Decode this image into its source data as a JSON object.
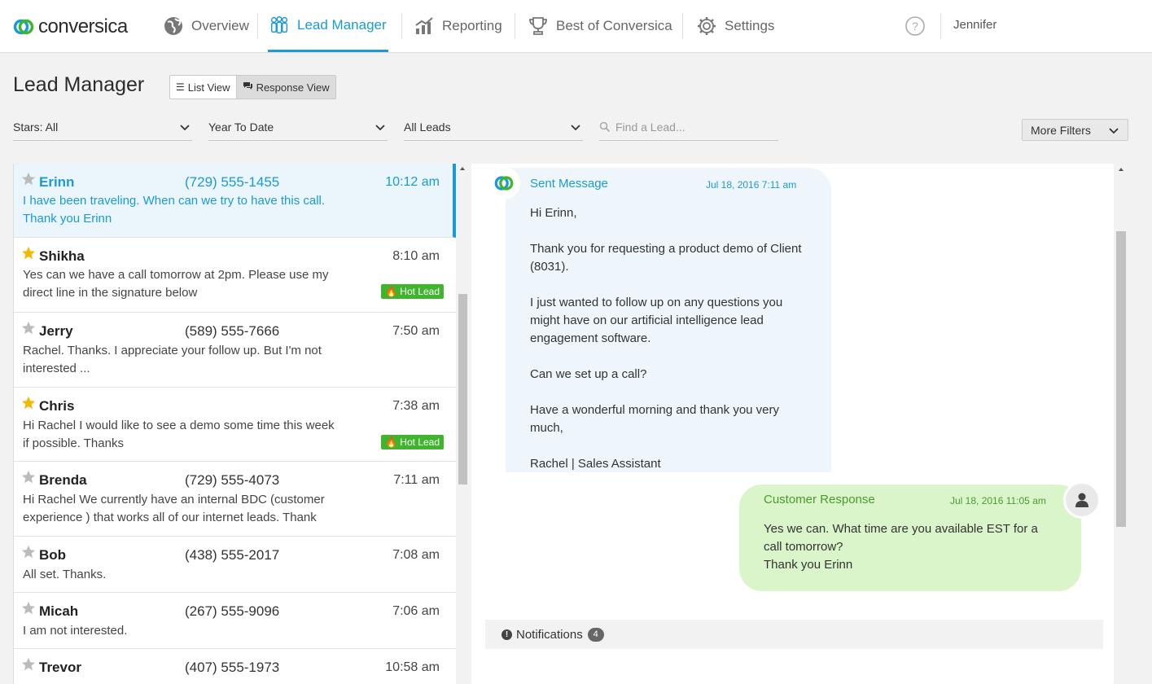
{
  "brand": {
    "name": "conversica"
  },
  "nav": {
    "items": [
      {
        "label": "Overview",
        "icon": "globe-icon"
      },
      {
        "label": "Lead Manager",
        "icon": "people-icon"
      },
      {
        "label": "Reporting",
        "icon": "chart-icon"
      },
      {
        "label": "Best of Conversica",
        "icon": "trophy-icon"
      },
      {
        "label": "Settings",
        "icon": "gear-icon"
      }
    ],
    "active": "Lead Manager",
    "help_icon": "help-icon",
    "user": "Jennifer"
  },
  "page": {
    "title": "Lead Manager",
    "views": {
      "list": "List View",
      "response": "Response View",
      "selected": "Response View"
    }
  },
  "filters": {
    "stars": "Stars: All",
    "period": "Year To Date",
    "leads": "All Leads",
    "search_placeholder": "Find a Lead...",
    "more": "More Filters"
  },
  "leads": [
    {
      "name": "Erinn",
      "phone": "(729) 555-1455",
      "time": "10:12 am",
      "starred": false,
      "selected": true,
      "hot": "",
      "preview": "I have been traveling. When can we try to have this call. Thank you Erinn"
    },
    {
      "name": "Shikha",
      "phone": "",
      "time": "8:10 am",
      "starred": true,
      "selected": false,
      "hot": "Hot Lead",
      "preview": "Yes can we have a call tomorrow at 2pm. Please use my direct line in the signature below"
    },
    {
      "name": "Jerry",
      "phone": "(589) 555-7666",
      "time": "7:50 am",
      "starred": false,
      "selected": false,
      "hot": "",
      "preview": "Rachel. Thanks. I appreciate your follow up. But I'm not interested ..."
    },
    {
      "name": "Chris",
      "phone": "",
      "time": "7:38 am",
      "starred": true,
      "selected": false,
      "hot": "Hot Lead",
      "preview": "Hi Rachel I would like to see a demo some time this week if possible. Thanks"
    },
    {
      "name": "Brenda",
      "phone": "(729) 555-4073",
      "time": "7:11 am",
      "starred": false,
      "selected": false,
      "hot": "",
      "preview": "Hi Rachel We currently have an internal BDC (customer experience ) that works all of our internet leads. Thank"
    },
    {
      "name": "Bob",
      "phone": "(438) 555-2017",
      "time": "7:08 am",
      "starred": false,
      "selected": false,
      "hot": "",
      "preview": "All set. Thanks."
    },
    {
      "name": "Micah",
      "phone": "(267) 555-9096",
      "time": "7:06 am",
      "starred": false,
      "selected": false,
      "hot": "",
      "preview": "I am not interested."
    },
    {
      "name": "Trevor",
      "phone": "(407) 555-1973",
      "time": "10:58 am",
      "starred": false,
      "selected": false,
      "hot": "",
      "preview": ""
    }
  ],
  "conversation": {
    "sent": {
      "label": "Sent Message",
      "date": "Jul 18, 2016 7:11 am",
      "paragraphs": [
        "Hi Erinn,",
        "Thank you for requesting a product demo of Client (8031).",
        "I just wanted to follow up on any questions you might have on our artificial intelligence lead engagement software.",
        "Can we set up a call?",
        "Have a wonderful morning and thank you very much,",
        "Rachel | Sales Assistant"
      ]
    },
    "response": {
      "label": "Customer Response",
      "date": "Jul 18, 2016 11:05 am",
      "lines": [
        "Yes we can. What time are you available EST for a call tomorrow?",
        "Thank you Erinn"
      ]
    },
    "notifications": {
      "label": "Notifications",
      "count": "4"
    }
  },
  "colors": {
    "accent": "#1a9ad6",
    "hot": "#3fb52d",
    "star": "#f5b800",
    "response_bg": "#d9f5c9",
    "sent_bg": "#eef6fb"
  }
}
